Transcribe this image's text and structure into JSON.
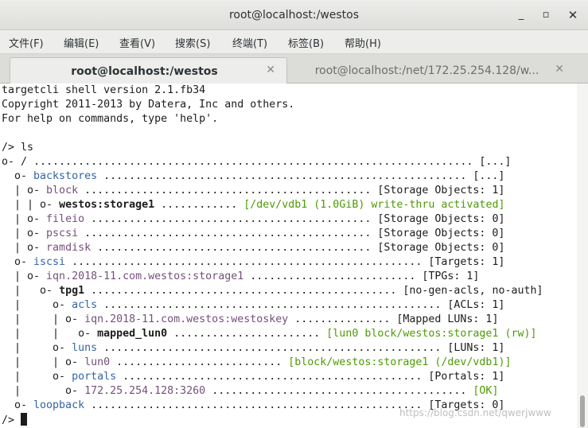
{
  "window": {
    "title": "root@localhost:/westos",
    "minimize_label": "_",
    "maximize_label": "▫",
    "close_label": "✕"
  },
  "menu": {
    "items": [
      {
        "label": "文件(F)"
      },
      {
        "label": "编辑(E)"
      },
      {
        "label": "查看(V)"
      },
      {
        "label": "搜索(S)"
      },
      {
        "label": "终端(T)"
      },
      {
        "label": "标签(B)"
      },
      {
        "label": "帮助(H)"
      }
    ]
  },
  "tabs": [
    {
      "label": "root@localhost:/westos",
      "close": "✕",
      "active": true
    },
    {
      "label": "root@localhost:/net/172.25.254.128/w...",
      "close": "✕",
      "active": false
    }
  ],
  "terminal": {
    "lines": [
      [
        {
          "t": "targetcli shell version 2.1.fb34"
        }
      ],
      [
        {
          "t": "Copyright 2011-2013 by Datera, Inc and others."
        }
      ],
      [
        {
          "t": "For help on commands, type 'help'."
        }
      ],
      [
        {
          "t": ""
        }
      ],
      [
        {
          "t": "/> ls"
        }
      ],
      [
        {
          "t": "o- / ..................................................................... [...]"
        }
      ],
      [
        {
          "t": "  o- "
        },
        {
          "t": "backstores",
          "c": "blue"
        },
        {
          "t": " ......................................................... [...]"
        }
      ],
      [
        {
          "t": "  | o- "
        },
        {
          "t": "block",
          "c": "magenta"
        },
        {
          "t": " ............................................. [Storage Objects: 1]"
        }
      ],
      [
        {
          "t": "  | | o- "
        },
        {
          "t": "westos:storage1",
          "c": "bold"
        },
        {
          "t": " ............ "
        },
        {
          "t": "[/dev/vdb1 (1.0GiB) write-thru activated]",
          "c": "green"
        }
      ],
      [
        {
          "t": "  | o- "
        },
        {
          "t": "fileio",
          "c": "magenta"
        },
        {
          "t": " ............................................ [Storage Objects: 0]"
        }
      ],
      [
        {
          "t": "  | o- "
        },
        {
          "t": "pscsi",
          "c": "magenta"
        },
        {
          "t": " ............................................. [Storage Objects: 0]"
        }
      ],
      [
        {
          "t": "  | o- "
        },
        {
          "t": "ramdisk",
          "c": "magenta"
        },
        {
          "t": " ........................................... [Storage Objects: 0]"
        }
      ],
      [
        {
          "t": "  o- "
        },
        {
          "t": "iscsi",
          "c": "blue"
        },
        {
          "t": " ....................................................... [Targets: 1]"
        }
      ],
      [
        {
          "t": "  | o- "
        },
        {
          "t": "iqn.2018-11.com.westos:storage1",
          "c": "magenta"
        },
        {
          "t": " .......................... [TPGs: 1]"
        }
      ],
      [
        {
          "t": "  |   o- "
        },
        {
          "t": "tpg1",
          "c": "bold"
        },
        {
          "t": " ................................................ [no-gen-acls, no-auth]"
        }
      ],
      [
        {
          "t": "  |     o- "
        },
        {
          "t": "acls",
          "c": "blue"
        },
        {
          "t": " ..................................................... [ACLs: 1]"
        }
      ],
      [
        {
          "t": "  |     | o- "
        },
        {
          "t": "iqn.2018-11.com.westos:westoskey",
          "c": "magenta"
        },
        {
          "t": " ............... [Mapped LUNs: 1]"
        }
      ],
      [
        {
          "t": "  |     |   o- "
        },
        {
          "t": "mapped_lun0",
          "c": "bold"
        },
        {
          "t": " ....................... "
        },
        {
          "t": "[lun0 block/westos:storage1 (rw)]",
          "c": "green"
        }
      ],
      [
        {
          "t": "  |     o- "
        },
        {
          "t": "luns",
          "c": "blue"
        },
        {
          "t": " ..................................................... [LUNs: 1]"
        }
      ],
      [
        {
          "t": "  |     | o- "
        },
        {
          "t": "lun0",
          "c": "magenta"
        },
        {
          "t": " .......................... "
        },
        {
          "t": "[block/westos:storage1 (/dev/vdb1)]",
          "c": "green"
        }
      ],
      [
        {
          "t": "  |     o- "
        },
        {
          "t": "portals",
          "c": "blue"
        },
        {
          "t": " ............................................... [Portals: 1]"
        }
      ],
      [
        {
          "t": "  |       o- "
        },
        {
          "t": "172.25.254.128:3260",
          "c": "magenta"
        },
        {
          "t": " ........................................ "
        },
        {
          "t": "[OK]",
          "c": "green"
        }
      ],
      [
        {
          "t": "  o- "
        },
        {
          "t": "loopback",
          "c": "blue"
        },
        {
          "t": " .................................................... [Targets: 0]"
        }
      ]
    ],
    "prompt": "/> "
  },
  "watermark": "https://blog.csdn.net/qwerjwww"
}
